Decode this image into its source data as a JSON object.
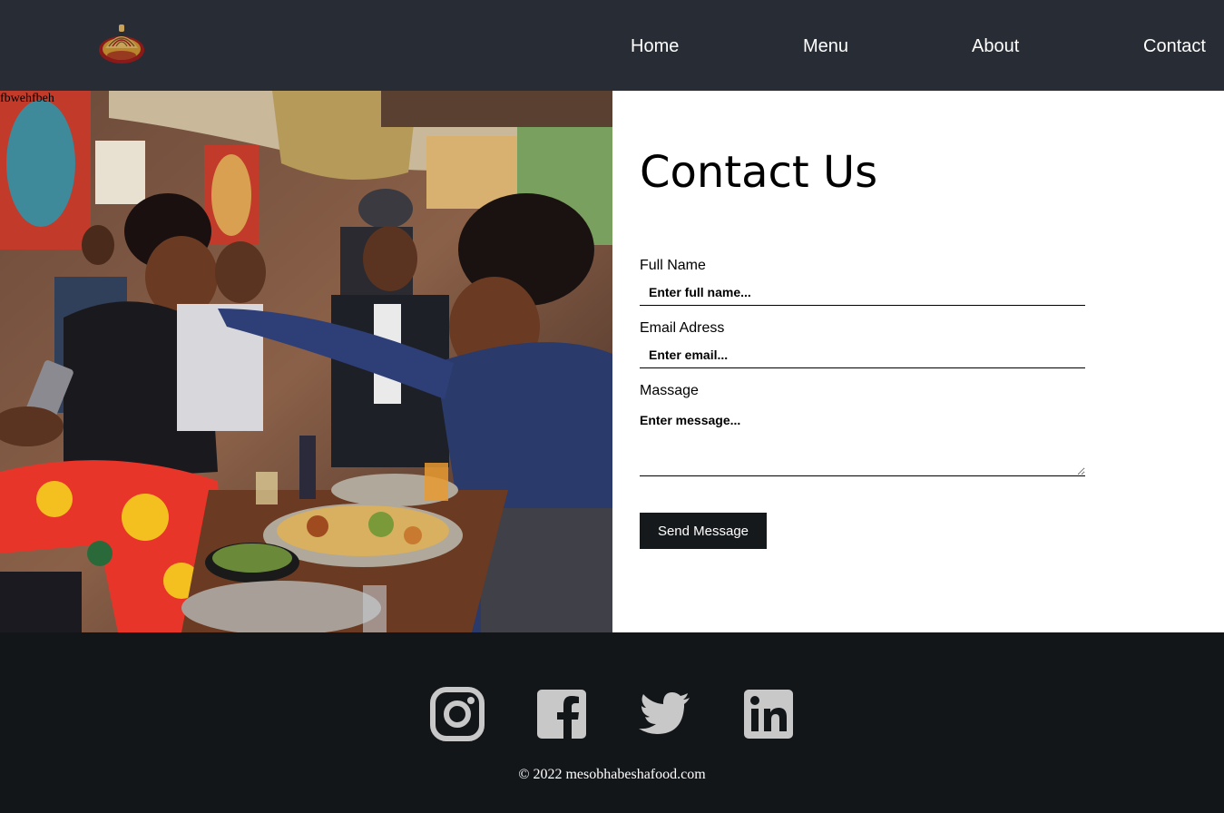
{
  "header": {
    "logo_icon": "mesob-basket-icon",
    "nav": {
      "home": "Home",
      "menu": "Menu",
      "about": "About",
      "contact": "Contact"
    }
  },
  "hero": {
    "image_alt_text": "fbwehfbeh"
  },
  "contact_form": {
    "title": "Contact Us",
    "full_name_label": "Full Name",
    "full_name_placeholder": "Enter full name...",
    "email_label": "Email Adress",
    "email_placeholder": "Enter email...",
    "message_label": "Massage",
    "message_placeholder": "Enter message...",
    "submit_label": "Send Message"
  },
  "footer": {
    "social_icons": [
      "instagram-icon",
      "facebook-icon",
      "twitter-icon",
      "linkedin-icon"
    ],
    "copyright": "© 2022 mesobhabeshafood.com"
  },
  "colors": {
    "header_bg": "#282c34",
    "footer_bg": "#131619",
    "button_bg": "#16191c",
    "icon_color": "#c8c8c8"
  }
}
